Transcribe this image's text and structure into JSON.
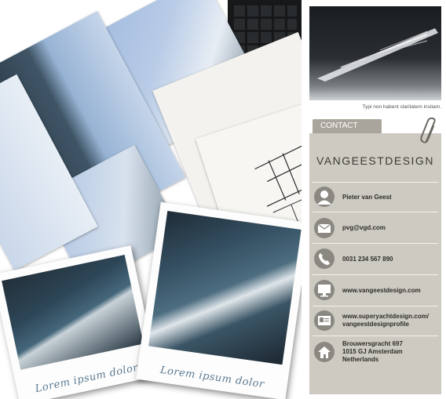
{
  "photo_caption": "Typi non habent claritatem insitam.",
  "contact": {
    "tab_label": "CONTACT",
    "logo_text": "VANGEESTDESIGN",
    "items": [
      {
        "icon": "person-icon",
        "lines": [
          "Pieter van Geest"
        ]
      },
      {
        "icon": "email-icon",
        "lines": [
          "pvg@vgd.com"
        ]
      },
      {
        "icon": "phone-icon",
        "lines": [
          "0031 234 567 890"
        ]
      },
      {
        "icon": "monitor-icon",
        "lines": [
          "www.vangeestdesign.com"
        ]
      },
      {
        "icon": "id-card-icon",
        "lines": [
          "www.superyachtdesign.com/",
          "vangeestdesignprofile"
        ]
      },
      {
        "icon": "house-icon",
        "lines": [
          "Brouwersgracht 697",
          "1015 GJ Amsterdam",
          "Netherlands"
        ]
      }
    ]
  },
  "polaroids": [
    {
      "caption": "Lorem ipsum dolor"
    },
    {
      "caption": "Lorem ipsum dolor"
    }
  ]
}
